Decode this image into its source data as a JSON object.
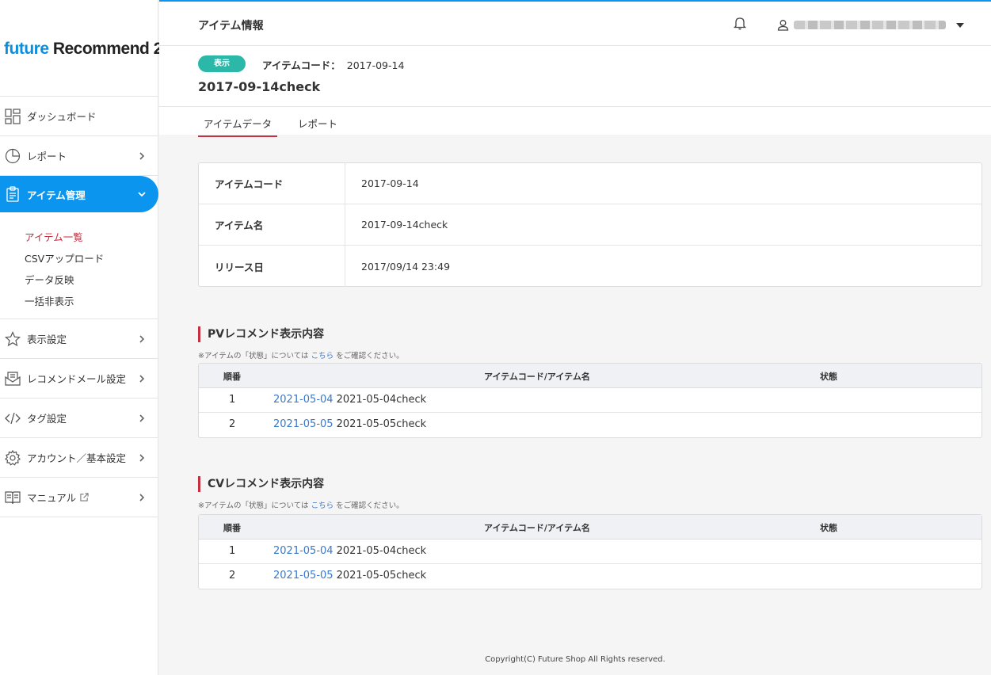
{
  "logo": {
    "part1": "future",
    "part2": " Recommend 2"
  },
  "sidebar": {
    "items": [
      {
        "label": "ダッシュボード"
      },
      {
        "label": "レポート"
      },
      {
        "label": "アイテム管理"
      },
      {
        "label": "表示設定"
      },
      {
        "label": "レコメンドメール設定"
      },
      {
        "label": "タグ設定"
      },
      {
        "label": "アカウント／基本設定"
      },
      {
        "label": "マニュアル"
      }
    ],
    "submenu": [
      "アイテム一覧",
      "CSVアップロード",
      "データ反映",
      "一括非表示"
    ]
  },
  "header": {
    "title": "アイテム情報"
  },
  "item": {
    "badge": "表示",
    "code_label": "アイテムコード：",
    "code_value": "2017-09-14",
    "title": "2017-09-14check"
  },
  "tabs": [
    "アイテムデータ",
    "レポート"
  ],
  "info": [
    {
      "key": "アイテムコード",
      "value": "2017-09-14"
    },
    {
      "key": "アイテム名",
      "value": "2017-09-14check"
    },
    {
      "key": "リリース日",
      "value": "2017/09/14 23:49"
    }
  ],
  "note": {
    "before": "※アイテムの「状態」については ",
    "link": "こちら",
    "after": " をご確認ください。"
  },
  "table_headers": {
    "order": "順番",
    "code_name": "アイテムコード/アイテム名",
    "status": "状態"
  },
  "pv": {
    "title": "PVレコメンド表示内容",
    "rows": [
      {
        "n": "1",
        "code": "2021-05-04",
        "name": "2021-05-04check"
      },
      {
        "n": "2",
        "code": "2021-05-05",
        "name": "2021-05-05check"
      }
    ]
  },
  "cv": {
    "title": "CVレコメンド表示内容",
    "rows": [
      {
        "n": "1",
        "code": "2021-05-04",
        "name": "2021-05-04check"
      },
      {
        "n": "2",
        "code": "2021-05-05",
        "name": "2021-05-05check"
      }
    ]
  },
  "footer": "Copyright(C) Future Shop All Rights reserved.",
  "icons": {
    "dashboard": "grid-icon",
    "report": "pie-chart-icon",
    "item": "clipboard-icon",
    "display": "star-icon",
    "mail": "mail-icon",
    "tag": "code-icon",
    "account": "gear-icon",
    "manual": "book-icon"
  },
  "colors": {
    "accent": "#0b95ef",
    "badge": "#2bb8a8",
    "red": "#c62f3f",
    "link": "#3a78c9"
  }
}
